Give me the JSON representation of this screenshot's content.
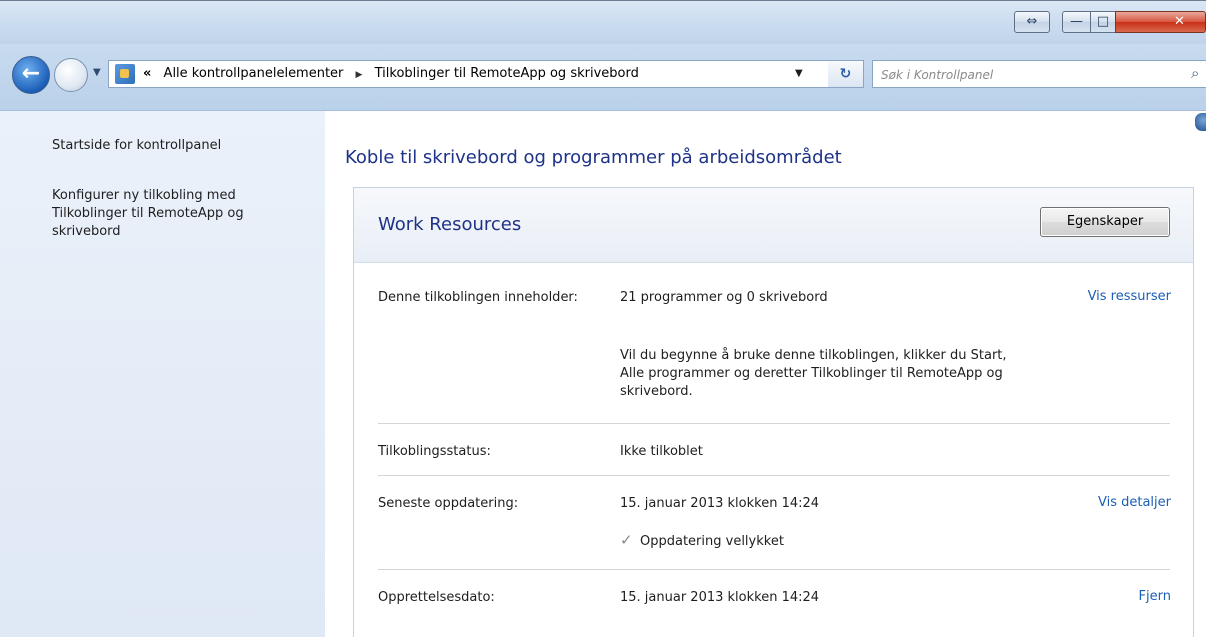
{
  "titlebar": {
    "restore_glyph": "⇔",
    "min_glyph": "—",
    "max_glyph": "□",
    "close_glyph": "✕"
  },
  "nav": {
    "back_glyph": "←",
    "dropdown_glyph": "▼",
    "breadcrumb_chevron": "«",
    "breadcrumb": [
      "Alle kontrollpanelelementer",
      "Tilkoblinger til RemoteApp og skrivebord"
    ],
    "separator_glyph": "▶",
    "refresh_glyph": "↻",
    "search_placeholder": "Søk i Kontrollpanel",
    "search_icon_glyph": "⌕"
  },
  "sidebar": {
    "items": [
      {
        "label": "Startside for kontrollpanel"
      },
      {
        "label": "Konfigurer ny tilkobling med Tilkoblinger til RemoteApp og skrivebord"
      }
    ]
  },
  "main": {
    "title": "Koble til skrivebord og programmer på arbeidsområdet",
    "card": {
      "title": "Work Resources",
      "properties_button": "Egenskaper",
      "rows": {
        "contents": {
          "label": "Denne tilkoblingen inneholder:",
          "value": "21 programmer og 0 skrivebord",
          "link": "Vis ressurser",
          "hint": "Vil du begynne å bruke denne tilkoblingen, klikker du Start, Alle programmer og deretter Tilkoblinger til RemoteApp og skrivebord."
        },
        "status": {
          "label": "Tilkoblingsstatus:",
          "value": "Ikke tilkoblet"
        },
        "updated": {
          "label": "Seneste oppdatering:",
          "value": "15. januar 2013 klokken 14:24",
          "link": "Vis detaljer",
          "result_icon": "✓",
          "result": "Oppdatering vellykket"
        },
        "created": {
          "label": "Opprettelsesdato:",
          "value": "15. januar 2013 klokken 14:24",
          "link": "Fjern"
        }
      }
    }
  }
}
